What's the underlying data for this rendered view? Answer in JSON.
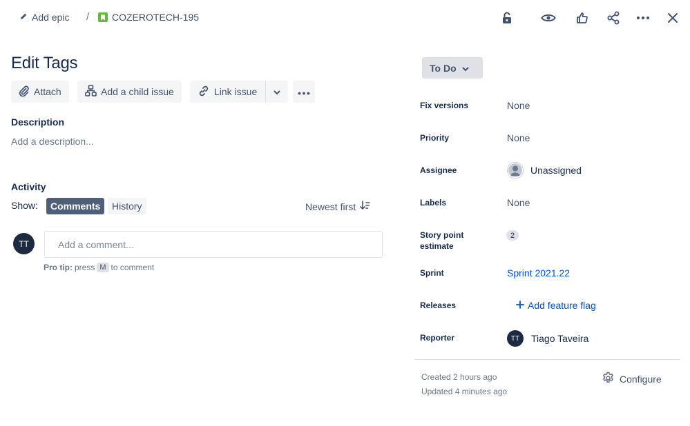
{
  "breadcrumb": {
    "add_epic": "Add epic",
    "separator": "/",
    "issue_key": "COZEROTECH-195"
  },
  "icons": {
    "pencil": "pencil-icon",
    "story": "story-icon",
    "lock": "lock-icon",
    "watch": "eye-icon",
    "vote": "thumbs-up-icon",
    "share": "share-icon",
    "more": "more-icon",
    "close": "close-icon"
  },
  "issue": {
    "title": "Edit Tags"
  },
  "actions": {
    "attach": "Attach",
    "add_child": "Add a child issue",
    "link_issue": "Link issue"
  },
  "description": {
    "heading": "Description",
    "placeholder": "Add a description..."
  },
  "activity": {
    "heading": "Activity",
    "show_label": "Show:",
    "tabs": [
      "Comments",
      "History"
    ],
    "active_tab": "Comments",
    "sort_label": "Newest first",
    "avatar_initials": "TT",
    "comment_placeholder": "Add a comment...",
    "pro_tip_label": "Pro tip:",
    "pro_tip_press": "press",
    "pro_tip_key": "M",
    "pro_tip_rest": "to comment"
  },
  "status": {
    "label": "To Do"
  },
  "fields": {
    "fix_versions": {
      "label": "Fix versions",
      "value": "None"
    },
    "priority": {
      "label": "Priority",
      "value": "None"
    },
    "assignee": {
      "label": "Assignee",
      "value": "Unassigned"
    },
    "labels": {
      "label": "Labels",
      "value": "None"
    },
    "story_points": {
      "label_line1": "Story point",
      "label_line2": "estimate",
      "value": "2"
    },
    "sprint": {
      "label": "Sprint",
      "value": "Sprint 2021.22"
    },
    "releases": {
      "label": "Releases",
      "value": "Add feature flag"
    },
    "reporter": {
      "label": "Reporter",
      "value": "Tiago Taveira",
      "initials": "TT"
    }
  },
  "meta": {
    "created": "Created 2 hours ago",
    "updated": "Updated 4 minutes ago",
    "configure": "Configure"
  },
  "colors": {
    "story_green": "#63ba3c",
    "link_blue": "#0052cc",
    "active_tab": "#505f79",
    "avatar_dark": "#1c2b41"
  }
}
